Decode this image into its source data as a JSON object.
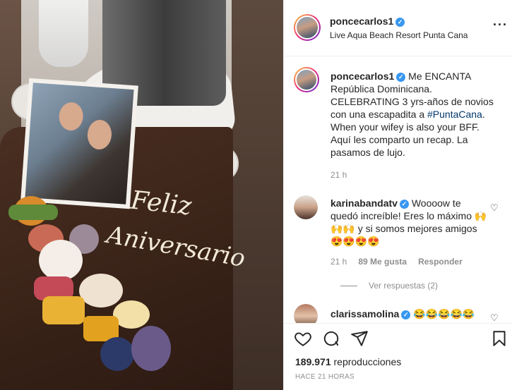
{
  "post": {
    "username": "poncecarlos1",
    "location": "Live Aqua Beach Resort Punta Cana",
    "verified": true,
    "more_icon": "more-horizontal-icon"
  },
  "media": {
    "card_text_line1": "Feliz",
    "card_text_line2": "Aniversario"
  },
  "caption": {
    "username": "poncecarlos1",
    "text_before_tag": "Me ENCANTA República Dominicana. CELEBRATING 3 yrs-años de novios con una escapadita a ",
    "hashtag": "#PuntaCana",
    "text_after_tag": ". When your wifey is also your BFF. Aquí les comparto un recap. La pasamos de lujo.",
    "time": "21 h"
  },
  "comments": [
    {
      "username": "karinabandatv",
      "verified": true,
      "text": "Woooow te quedó increíble! Eres lo máximo 🙌🙌🙌 y si somos mejores amigos 😍😍😍😍",
      "time": "21 h",
      "likes": "89 Me gusta",
      "reply": "Responder",
      "view_replies": "Ver respuestas (2)"
    },
    {
      "username": "clarissamolina",
      "verified": true,
      "text": "😂😂😂😂😂"
    }
  ],
  "actions": {
    "like_icon": "heart-icon",
    "comment_icon": "comment-icon",
    "share_icon": "share-icon",
    "save_icon": "bookmark-icon",
    "views_count": "189.971",
    "views_label": "reproducciones",
    "posted_ago": "HACE 21 HORAS"
  },
  "colors": {
    "verified": "#3897f0",
    "link": "#00376b",
    "muted": "#8e8e8e"
  }
}
